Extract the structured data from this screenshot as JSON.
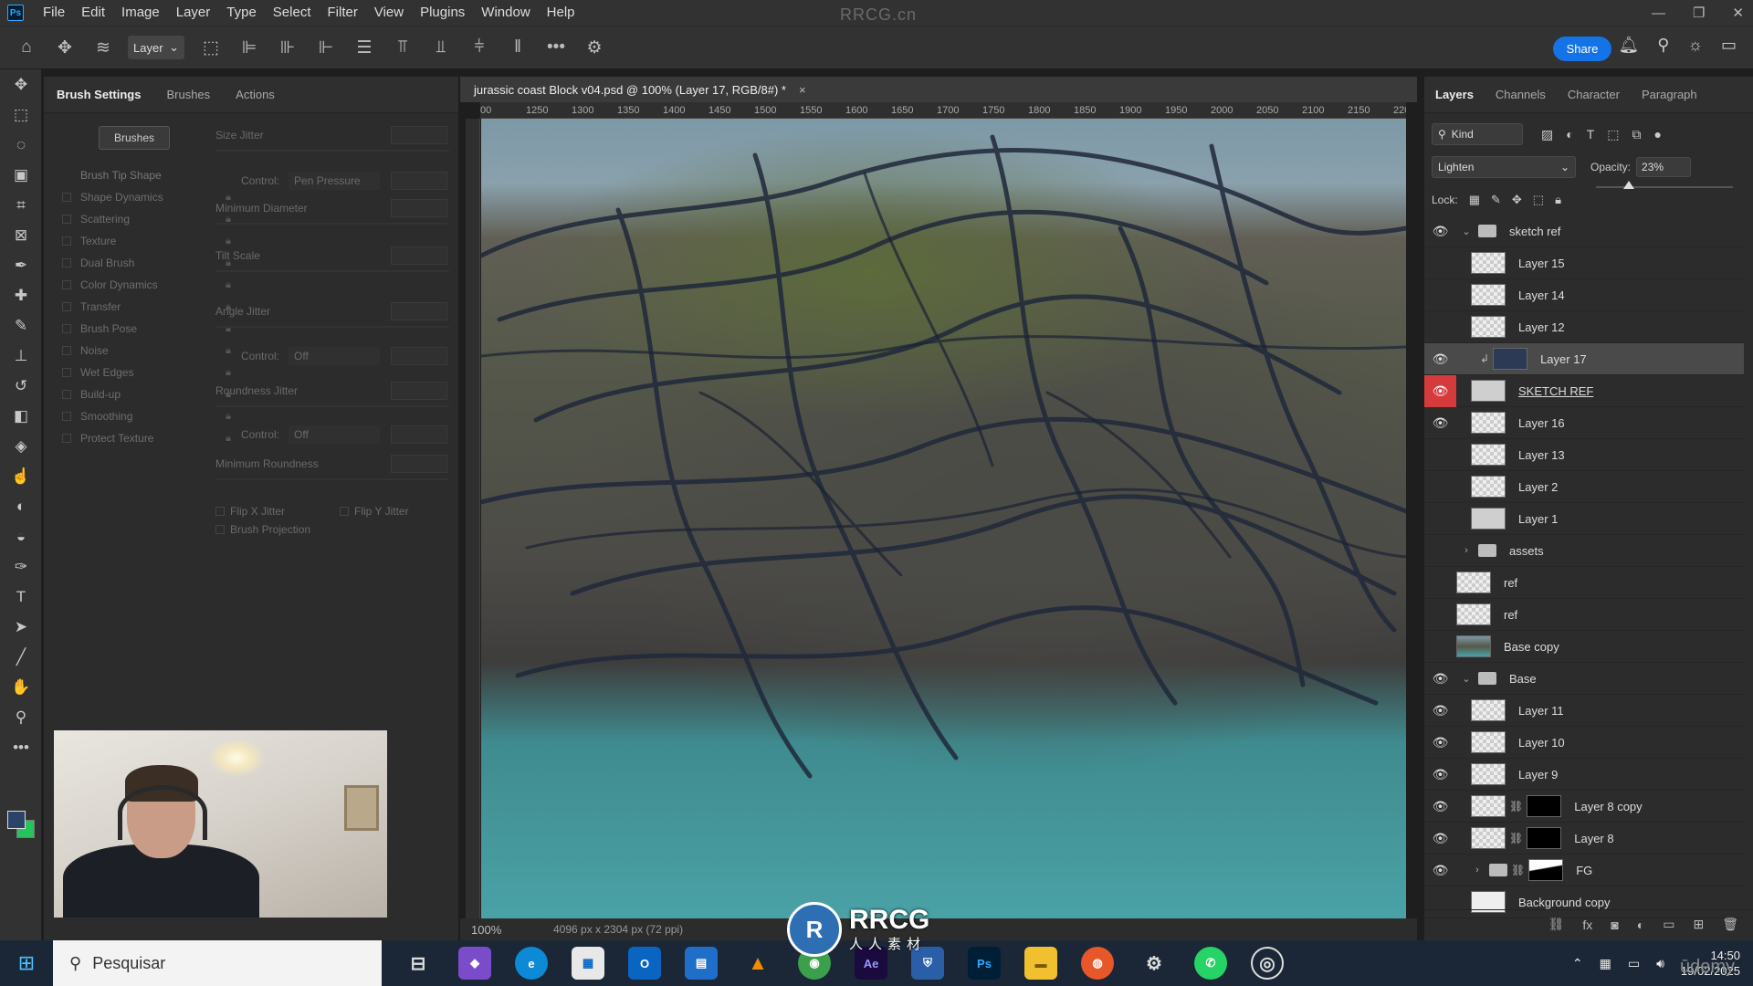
{
  "menubar": {
    "logo": "Ps",
    "items": [
      "File",
      "Edit",
      "Image",
      "Layer",
      "Type",
      "Select",
      "Filter",
      "View",
      "Plugins",
      "Window",
      "Help"
    ],
    "watermark": "RRCG.cn",
    "window_controls": [
      "—",
      "❐",
      "✕"
    ]
  },
  "optionsbar": {
    "auto_select_value": "Layer",
    "share_label": "Share"
  },
  "brush_panel": {
    "tabs": [
      "Brush Settings",
      "Brushes",
      "Actions"
    ],
    "brushes_button": "Brushes",
    "tip_shape": "Brush Tip Shape",
    "options": [
      "Shape Dynamics",
      "Scattering",
      "Texture",
      "Dual Brush",
      "Color Dynamics",
      "Transfer",
      "Brush Pose",
      "Noise",
      "Wet Edges",
      "Build-up",
      "Smoothing",
      "Protect Texture"
    ],
    "size_jitter": "Size Jitter",
    "control1_label": "Control:",
    "control1_value": "Pen Pressure",
    "minimum_diameter": "Minimum Diameter",
    "tilt_scale": "Tilt Scale",
    "angle_jitter": "Angle Jitter",
    "control2_label": "Control:",
    "control2_value": "Off",
    "roundness_jitter": "Roundness Jitter",
    "control3_label": "Control:",
    "control3_value": "Off",
    "minimum_roundness": "Minimum Roundness",
    "flip_x": "Flip X Jitter",
    "flip_y": "Flip Y Jitter",
    "brush_projection": "Brush Projection"
  },
  "document": {
    "tab_title": "jurassic coast Block v04.psd @ 100% (Layer 17, RGB/8#) *",
    "close": "×",
    "ruler_ticks": [
      "00",
      "1250",
      "1300",
      "1350",
      "1400",
      "1450",
      "1500",
      "1550",
      "1600",
      "1650",
      "1700",
      "1750",
      "1800",
      "1850",
      "1900",
      "1950",
      "2000",
      "2050",
      "2100",
      "2150",
      "220"
    ],
    "zoom": "100%",
    "dimensions": "4096 px x 2304 px (72 ppi)"
  },
  "layers_panel": {
    "tabs": [
      "Layers",
      "Channels",
      "Character",
      "Paragraph"
    ],
    "kind_label": "Kind",
    "blend_mode": "Lighten",
    "opacity_label": "Opacity:",
    "opacity_value": "23%",
    "opacity_level": 0.23,
    "lock_label": "Lock:",
    "layers": [
      {
        "name": "sketch ref",
        "kind": "group",
        "visible": true
      },
      {
        "name": "Layer 15",
        "kind": "layer",
        "visible": false
      },
      {
        "name": "Layer 14",
        "kind": "layer",
        "visible": false
      },
      {
        "name": "Layer 12",
        "kind": "layer",
        "visible": false
      },
      {
        "name": "Layer 17",
        "kind": "layer",
        "visible": true,
        "selected": true
      },
      {
        "name": "SKETCH REF",
        "kind": "layer",
        "visible": true
      },
      {
        "name": "Layer 16",
        "kind": "layer",
        "visible": true
      },
      {
        "name": "Layer 13",
        "kind": "layer",
        "visible": false
      },
      {
        "name": "Layer 2",
        "kind": "layer",
        "visible": false
      },
      {
        "name": "Layer 1",
        "kind": "layer",
        "visible": false
      },
      {
        "name": "assets",
        "kind": "group",
        "visible": false
      },
      {
        "name": "ref",
        "kind": "layer",
        "visible": false
      },
      {
        "name": "ref",
        "kind": "layer",
        "visible": false
      },
      {
        "name": "Base copy",
        "kind": "layer",
        "visible": false
      },
      {
        "name": "Base",
        "kind": "group",
        "visible": true
      },
      {
        "name": "Layer 11",
        "kind": "layer",
        "visible": true
      },
      {
        "name": "Layer 10",
        "kind": "layer",
        "visible": true
      },
      {
        "name": "Layer 9",
        "kind": "layer",
        "visible": true
      },
      {
        "name": "Layer 8 copy",
        "kind": "layer",
        "visible": true
      },
      {
        "name": "Layer 8",
        "kind": "layer",
        "visible": true
      },
      {
        "name": "FG",
        "kind": "group",
        "visible": true
      },
      {
        "name": "Background copy",
        "kind": "layer",
        "visible": false
      }
    ]
  },
  "taskbar": {
    "search_placeholder": "Pesquisar",
    "time": "14:50",
    "date": "19/02/2025",
    "apps": [
      "Ae",
      "Ps"
    ]
  },
  "overlay": {
    "logo_text": "RRCG",
    "logo_sub": "人人素材",
    "udemy": "ūdemy"
  }
}
